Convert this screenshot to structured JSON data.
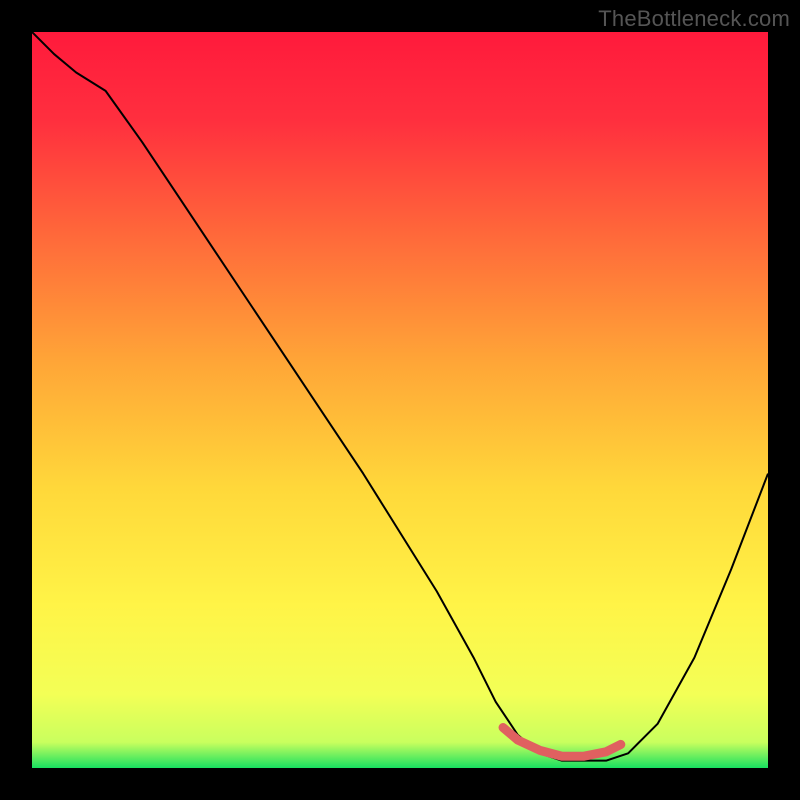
{
  "watermark": "TheBottleneck.com",
  "chart_data": {
    "type": "line",
    "title": "",
    "xlabel": "",
    "ylabel": "",
    "xlim": [
      0,
      100
    ],
    "ylim": [
      0,
      100
    ],
    "gradient_stops": [
      {
        "offset": 0.0,
        "color": "#ff1a3c"
      },
      {
        "offset": 0.12,
        "color": "#ff2f3e"
      },
      {
        "offset": 0.28,
        "color": "#ff6a3a"
      },
      {
        "offset": 0.45,
        "color": "#ffa637"
      },
      {
        "offset": 0.62,
        "color": "#ffd83a"
      },
      {
        "offset": 0.78,
        "color": "#fff447"
      },
      {
        "offset": 0.9,
        "color": "#f3ff56"
      },
      {
        "offset": 0.965,
        "color": "#c9ff5e"
      },
      {
        "offset": 1.0,
        "color": "#18e060"
      }
    ],
    "series": [
      {
        "name": "bottleneck-curve",
        "color": "#000000",
        "stroke_width": 2,
        "x": [
          0,
          3,
          6,
          10,
          15,
          20,
          25,
          30,
          35,
          40,
          45,
          50,
          55,
          60,
          63,
          66,
          69,
          72,
          75,
          78,
          81,
          85,
          90,
          95,
          100
        ],
        "y": [
          100,
          97,
          94.5,
          92,
          85,
          77.5,
          70,
          62.5,
          55,
          47.5,
          40,
          32,
          24,
          15,
          9,
          4.5,
          2,
          1,
          1,
          1,
          2,
          6,
          15,
          27,
          40
        ]
      }
    ],
    "highlight": {
      "name": "optimal-range",
      "color": "#e06060",
      "stroke_width": 9,
      "linecap": "round",
      "x": [
        64,
        66,
        69,
        72,
        75,
        78,
        80
      ],
      "y": [
        5.5,
        3.8,
        2.4,
        1.6,
        1.6,
        2.2,
        3.2
      ]
    }
  }
}
